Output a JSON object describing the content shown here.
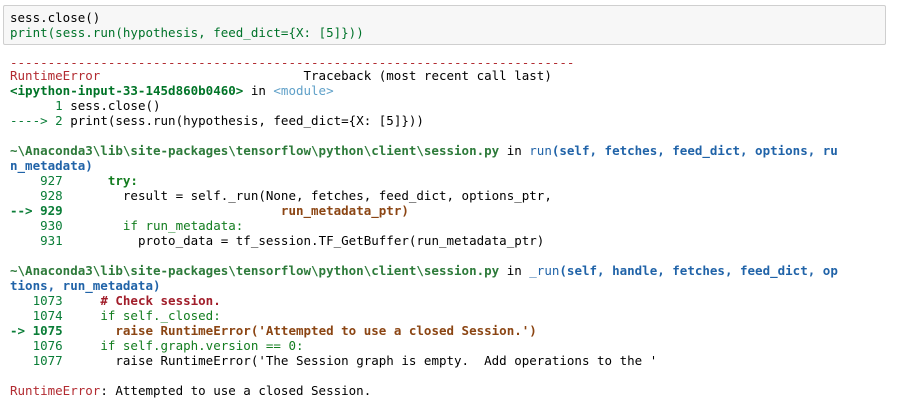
{
  "input_cell": {
    "line1": "sess.close()",
    "line2_fn": "print",
    "line2_rest": "(sess.run(hypothesis, feed_dict={X: [5]}))"
  },
  "tb": {
    "dashes": "---------------------------------------------------------------------------",
    "err_name": "RuntimeError",
    "tb_header": "                           Traceback (most recent call last)",
    "ipy_input": "<ipython-input-33-145d860b0460>",
    "in": " in ",
    "module": "<module>",
    "f1_l1_num": "      1 ",
    "f1_l1_code": "sess.close()",
    "f1_l2_arrow": "----> 2 ",
    "f1_l2_code": "print(sess.run(hypothesis, feed_dict={X: [5]}))",
    "f2_path": "~\\Anaconda3\\lib\\site-packages\\tensorflow\\python\\client\\session.py",
    "f2_in": " in ",
    "f2_func": "run",
    "f2_args_1": "(self, fetches, feed_dict, options, ru",
    "f2_args_2": "n_metadata)",
    "f2_927_num": "    927 ",
    "f2_927_code": "     try:",
    "f2_928_num": "    928 ",
    "f2_928_code": "       result = self._run(None, fetches, feed_dict, options_ptr,",
    "f2_929_num": "--> 929 ",
    "f2_929_code": "                            run_metadata_ptr)",
    "f2_930_num": "    930 ",
    "f2_930_code": "       if run_metadata:",
    "f2_931_num": "    931 ",
    "f2_931_code": "         proto_data = tf_session.TF_GetBuffer(run_metadata_ptr)",
    "f3_path": "~\\Anaconda3\\lib\\site-packages\\tensorflow\\python\\client\\session.py",
    "f3_in": " in ",
    "f3_func": "_run",
    "f3_args_1": "(self, handle, fetches, feed_dict, op",
    "f3_args_2": "tions, run_metadata)",
    "f3_1073_num": "   1073 ",
    "f3_1073_code": "    # Check session.",
    "f3_1074_num": "   1074 ",
    "f3_1074_code": "    if self._closed:",
    "f3_1075_num": "-> 1075 ",
    "f3_1075_code": "      raise RuntimeError('Attempted to use a closed Session.')",
    "f3_1076_num": "   1076 ",
    "f3_1076_code": "    if self.graph.version == 0:",
    "f3_1077_num": "   1077 ",
    "f3_1077_code": "      raise RuntimeError('The Session graph is empty.  Add operations to the '",
    "final_err": "RuntimeError",
    "final_msg": ": Attempted to use a closed Session."
  }
}
